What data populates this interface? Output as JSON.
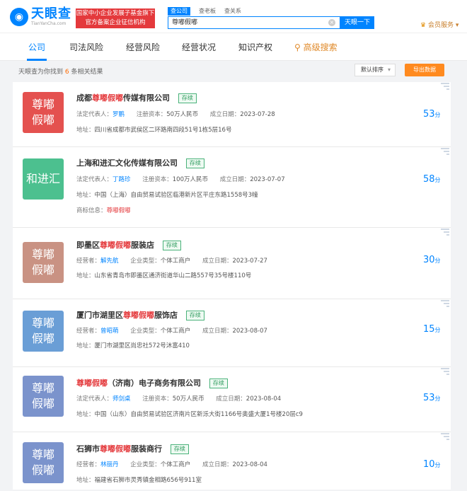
{
  "header": {
    "logo_text": "天眼查",
    "logo_sub": "TianYanCha.com",
    "badge_line1": "国家中小企业发展子基金旗下",
    "badge_line2": "官方备案企业征信机构",
    "search_tabs": [
      "查公司",
      "查老板",
      "查关系"
    ],
    "search_value": "尊嘟假嘟",
    "search_button": "天眼一下",
    "member": "会员服务"
  },
  "nav": {
    "items": [
      "公司",
      "司法风险",
      "经营风险",
      "经营状况",
      "知识产权",
      "高级搜索"
    ]
  },
  "results": {
    "prefix": "天眼查为你找到",
    "count": "6",
    "suffix": "条相关结果",
    "sort_label": "默认排序",
    "export_label": "导出数据"
  },
  "cards": [
    {
      "logo_line1": "尊嘟",
      "logo_line2": "假嘟",
      "logo_color": "#e4514f",
      "title_pre": "成都",
      "title_hl": "尊嘟假嘟",
      "title_post": "传媒有限公司",
      "tag": "存续",
      "rep_label": "法定代表人：",
      "rep": "罗鹏",
      "f2_label": "注册资本：",
      "f2": "50万人民币",
      "date_label": "成立日期：",
      "date": "2023-07-28",
      "addr_label": "地址：",
      "addr": "四川省成都市武侯区二环路南四段51号1栋5层16号",
      "score": "53",
      "score_unit": "分"
    },
    {
      "logo_line1": "和进汇",
      "logo_line2": "",
      "logo_color": "#4cc08f",
      "title_pre": "上海和进汇文化传媒有限公司",
      "title_hl": "",
      "title_post": "",
      "tag": "存续",
      "rep_label": "法定代表人：",
      "rep": "丁路珍",
      "f2_label": "注册资本：",
      "f2": "100万人民币",
      "date_label": "成立日期：",
      "date": "2023-07-07",
      "addr_label": "地址：",
      "addr": "中国（上海）自由贸易试验区临港新片区平庄东路1558号3幢",
      "brand_label": "商标信息：",
      "brand": "尊嘟假嘟",
      "score": "58",
      "score_unit": "分"
    },
    {
      "logo_line1": "尊嘟",
      "logo_line2": "假嘟",
      "logo_color": "#c99283",
      "title_pre": "即墨区",
      "title_hl": "尊嘟假嘟",
      "title_post": "服装店",
      "tag": "存续",
      "rep_label": "经营者：",
      "rep": "解先航",
      "f2_label": "企业类型：",
      "f2": "个体工商户",
      "date_label": "成立日期：",
      "date": "2023-07-27",
      "addr_label": "地址：",
      "addr": "山东省青岛市即墨区通济街道华山二路557号35号楼110号",
      "score": "30",
      "score_unit": "分"
    },
    {
      "logo_line1": "尊嘟",
      "logo_line2": "假嘟",
      "logo_color": "#6a9ed6",
      "title_pre": "厦门市湖里区",
      "title_hl": "尊嘟假嘟",
      "title_post": "服饰店",
      "tag": "存续",
      "rep_label": "经营者：",
      "rep": "曾昭萌",
      "f2_label": "企业类型：",
      "f2": "个体工商户",
      "date_label": "成立日期：",
      "date": "2023-08-07",
      "addr_label": "地址：",
      "addr": "厦门市湖里区尚忠社572号沐富410",
      "score": "15",
      "score_unit": "分"
    },
    {
      "logo_line1": "尊嘟",
      "logo_line2": "假嘟",
      "logo_color": "#7b93cc",
      "title_pre": "",
      "title_hl": "尊嘟假嘟",
      "title_post": "（济南）电子商务有限公司",
      "tag": "存续",
      "rep_label": "法定代表人：",
      "rep": "师剑桌",
      "f2_label": "注册资本：",
      "f2": "50万人民币",
      "date_label": "成立日期：",
      "date": "2023-08-04",
      "addr_label": "地址：",
      "addr": "中国（山东）自由贸易试验区济南片区新泺大街1166号奥盛大厦1号楼20层c9",
      "score": "53",
      "score_unit": "分"
    },
    {
      "logo_line1": "尊嘟",
      "logo_line2": "假嘟",
      "logo_color": "#7b93cc",
      "title_pre": "石狮市",
      "title_hl": "尊嘟假嘟",
      "title_post": "服装商行",
      "tag": "存续",
      "rep_label": "经营者：",
      "rep": "林丽丹",
      "f2_label": "企业类型：",
      "f2": "个体工商户",
      "date_label": "成立日期：",
      "date": "2023-08-04",
      "addr_label": "地址：",
      "addr": "福建省石狮市灵秀镇金相路656号911室",
      "score": "10",
      "score_unit": "分"
    }
  ]
}
